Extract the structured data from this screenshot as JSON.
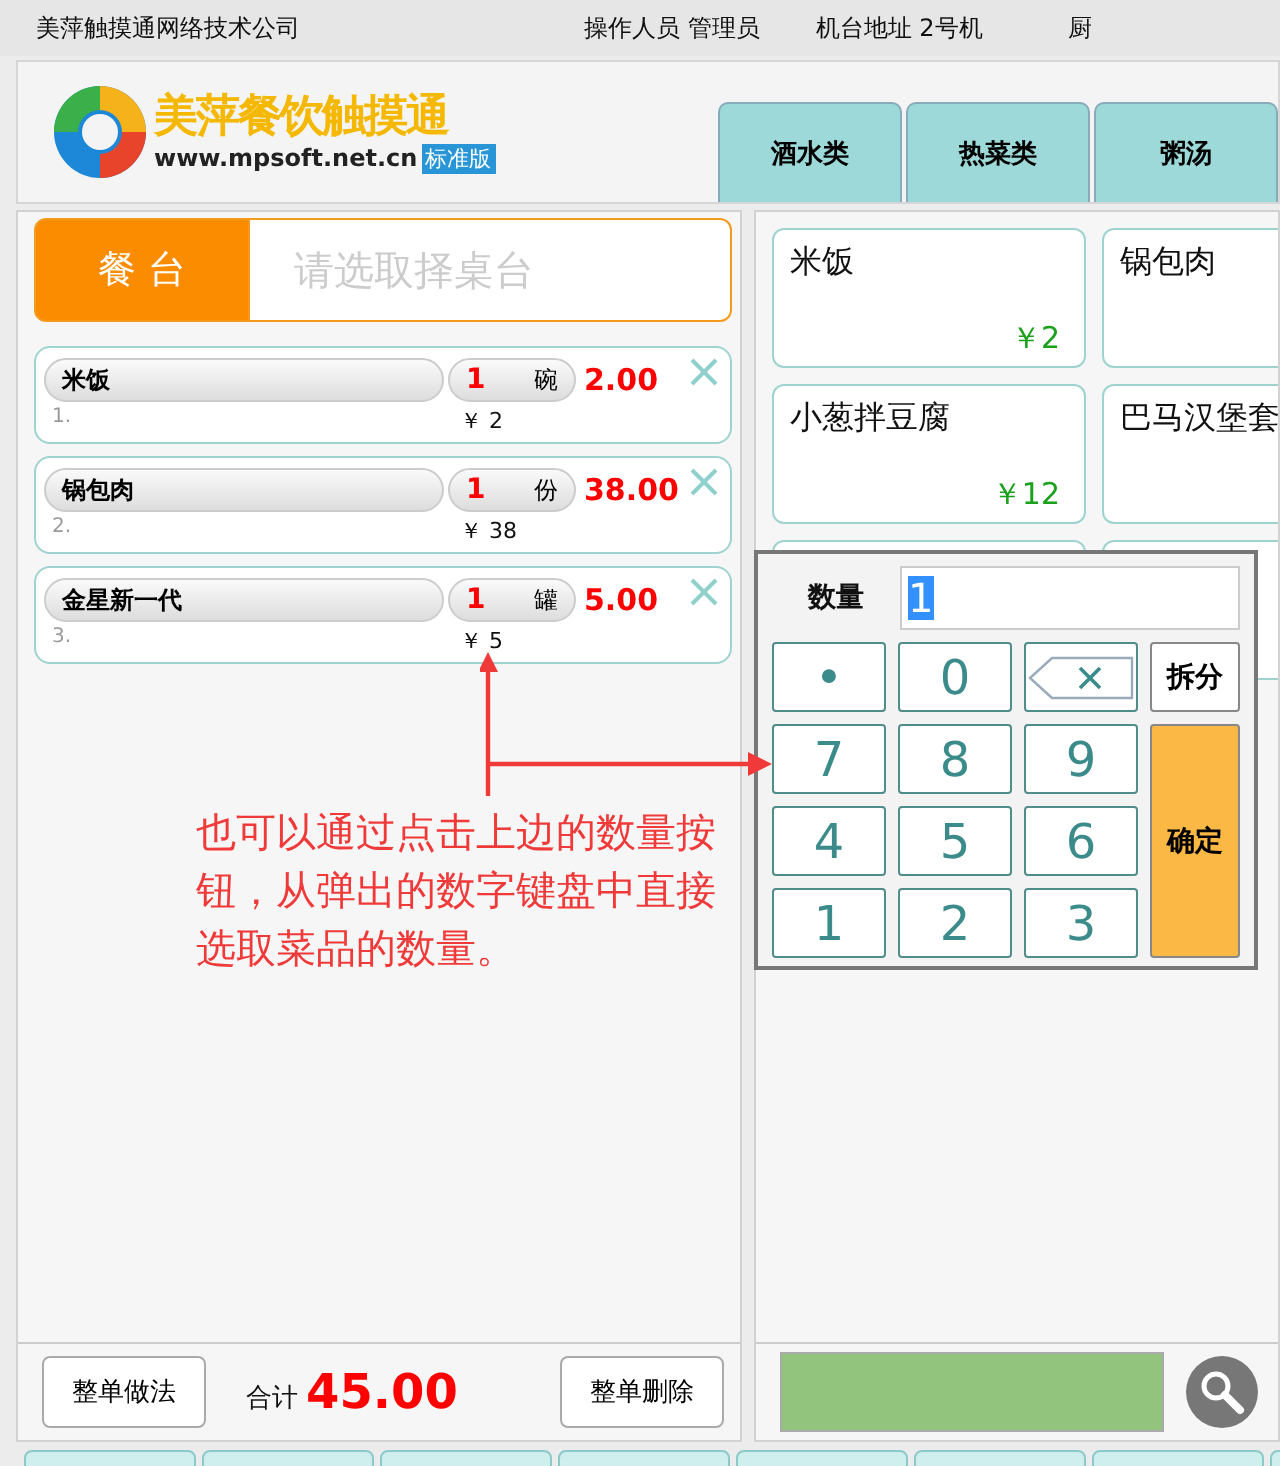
{
  "top_bar": {
    "company": "美萍触摸通网络技术公司",
    "operator": "操作人员 管理员",
    "terminal": "机台地址  2号机",
    "cut_item": "厨"
  },
  "logo": {
    "title": "美萍餐饮触摸通",
    "url": "www.mpsoft.net.cn",
    "edition": "标准版"
  },
  "category_tabs": [
    {
      "label": "酒水类",
      "selected": false
    },
    {
      "label": "热菜类",
      "selected": false
    },
    {
      "label": "粥汤",
      "selected": false
    }
  ],
  "table_selector": {
    "button": "餐 台",
    "placeholder": "请选取择桌台"
  },
  "order_items": [
    {
      "name": "米饭",
      "qty": "1",
      "unit": "碗",
      "amount": "2.00",
      "index": "1.",
      "unit_price": "￥ 2"
    },
    {
      "name": "锅包肉",
      "qty": "1",
      "unit": "份",
      "amount": "38.00",
      "index": "2.",
      "unit_price": "￥ 38"
    },
    {
      "name": "金星新一代",
      "qty": "1",
      "unit": "罐",
      "amount": "5.00",
      "index": "3.",
      "unit_price": "￥ 5"
    }
  ],
  "footer": {
    "left_button": "整单做法",
    "total_label": "合计",
    "total": "45.00",
    "right_button": "整单删除"
  },
  "dishes": [
    {
      "name": "米饭",
      "price": "￥2"
    },
    {
      "name": "锅包肉"
    },
    {
      "name": "小葱拌豆腐",
      "price": "￥12"
    },
    {
      "name": "巴马汉堡套"
    }
  ],
  "keypad": {
    "label": "数量",
    "value": "1",
    "keys": [
      {
        "kind": "key",
        "label": "•"
      },
      {
        "kind": "key",
        "label": "0"
      },
      {
        "kind": "backspace"
      },
      {
        "kind": "key",
        "label": "7"
      },
      {
        "kind": "key",
        "label": "8"
      },
      {
        "kind": "key",
        "label": "9"
      },
      {
        "kind": "key",
        "label": "4"
      },
      {
        "kind": "key",
        "label": "5"
      },
      {
        "kind": "key",
        "label": "6"
      },
      {
        "kind": "key",
        "label": "1"
      },
      {
        "kind": "key",
        "label": "2"
      },
      {
        "kind": "key",
        "label": "3"
      }
    ],
    "side_keys": [
      {
        "kind": "action",
        "label": "拆分"
      },
      {
        "kind": "confirm",
        "label": "确定"
      }
    ]
  },
  "annotation": "也可以通过点击上边的数量按钮，从弹出的数字键盘中直接选取菜品的数量。"
}
